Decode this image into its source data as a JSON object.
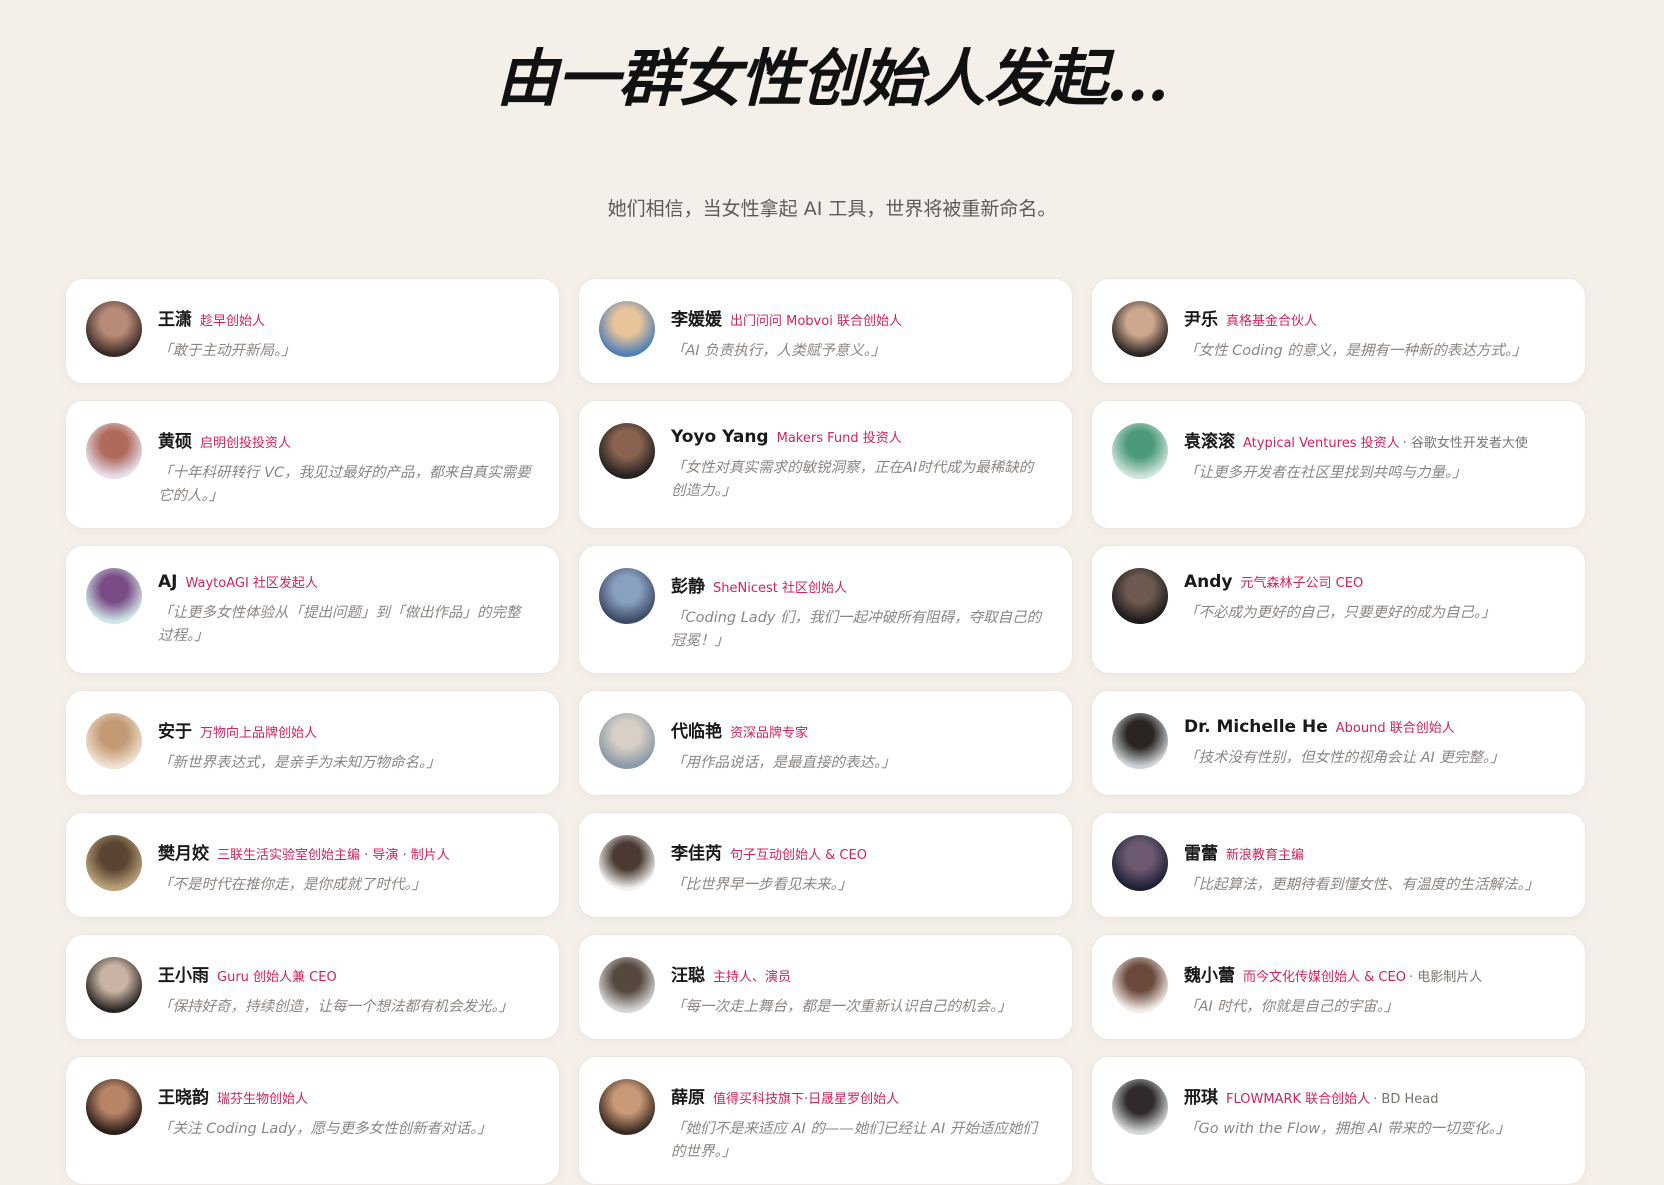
{
  "header": {
    "title": "由一群女性创始人发起...",
    "subtitle": "她们相信，当女性拿起 AI 工具，世界将被重新命名。"
  },
  "cards": [
    {
      "name": "王潇",
      "role": "趁早创始人",
      "extra": "",
      "quote": "「敢于主动开新局。」",
      "avatar_colors": [
        "#3a2a26",
        "#b88b78"
      ]
    },
    {
      "name": "李媛媛",
      "role": "出门问问 Mobvoi 联合创始人",
      "extra": "",
      "quote": "「AI 负责执行，人类赋予意义。」",
      "avatar_colors": [
        "#4f7fb4",
        "#e9c39a"
      ]
    },
    {
      "name": "尹乐",
      "role": "真格基金合伙人",
      "extra": "",
      "quote": "「女性 Coding 的意义，是拥有一种新的表达方式。」",
      "avatar_colors": [
        "#2b2623",
        "#cda88e"
      ]
    },
    {
      "name": "黄硕",
      "role": "启明创投投资人",
      "extra": "",
      "quote": "「十年科研转行 VC，我见过最好的产品，都来自真实需要它的人。」",
      "avatar_colors": [
        "#e8dfee",
        "#b06a5a"
      ]
    },
    {
      "name": "Yoyo Yang",
      "role": "Makers Fund 投资人",
      "extra": "",
      "quote": "「女性对真实需求的敏锐洞察，正在AI时代成为最稀缺的创造力。」",
      "avatar_colors": [
        "#23201f",
        "#8a6450"
      ]
    },
    {
      "name": "袁滚滚",
      "role": "Atypical Ventures 投资人",
      "extra": "· 谷歌女性开发者大使",
      "quote": "「让更多开发者在社区里找到共鸣与力量。」",
      "avatar_colors": [
        "#cfe4dc",
        "#4a9a7a"
      ]
    },
    {
      "name": "AJ",
      "role": "WaytoAGI 社区发起人",
      "extra": "",
      "quote": "「让更多女性体验从「提出问题」到「做出作品」的完整过程。」",
      "avatar_colors": [
        "#cfe7e6",
        "#7a4c86"
      ]
    },
    {
      "name": "彭静",
      "role": "SheNicest 社区创始人",
      "extra": "",
      "quote": "「Coding Lady 们，我们一起冲破所有阻碍，夺取自己的冠冕！」",
      "avatar_colors": [
        "#3d4a66",
        "#8aa0c0"
      ]
    },
    {
      "name": "Andy",
      "role": "元气森林子公司 CEO",
      "extra": "",
      "quote": "「不必成为更好的自己，只要更好的成为自己。」",
      "avatar_colors": [
        "#1e1b1b",
        "#6e5a50"
      ]
    },
    {
      "name": "安于",
      "role": "万物向上品牌创始人",
      "extra": "",
      "quote": "「新世界表达式，是亲手为未知万物命名。」",
      "avatar_colors": [
        "#efe2d2",
        "#c49a74"
      ]
    },
    {
      "name": "代临艳",
      "role": "资深品牌专家",
      "extra": "",
      "quote": "「用作品说话，是最直接的表达。」",
      "avatar_colors": [
        "#8a9aa8",
        "#d8cfc6"
      ]
    },
    {
      "name": "Dr. Michelle He",
      "role": "Abound 联合创始人",
      "extra": "",
      "quote": "「技术没有性别，但女性的视角会让 AI 更完整。」",
      "avatar_colors": [
        "#cdd3d6",
        "#2a2522"
      ]
    },
    {
      "name": "樊月姣",
      "role": "三联生活实验室创始主编 · 导演 · 制片人",
      "extra": "",
      "quote": "「不是时代在推你走，是你成就了时代。」",
      "avatar_colors": [
        "#b9a27a",
        "#5a4432"
      ]
    },
    {
      "name": "李佳芮",
      "role": "句子互动创始人 & CEO",
      "extra": "",
      "quote": "「比世界早一步看见未来。」",
      "avatar_colors": [
        "#f3f1ef",
        "#4a3a33"
      ]
    },
    {
      "name": "雷蕾",
      "role": "新浪教育主编",
      "extra": "",
      "quote": "「比起算法，更期待看到懂女性、有温度的生活解法。」",
      "avatar_colors": [
        "#1d2036",
        "#6d5a70"
      ]
    },
    {
      "name": "王小雨",
      "role": "Guru 创始人兼 CEO",
      "extra": "",
      "quote": "「保持好奇，持续创造，让每一个想法都有机会发光。」",
      "avatar_colors": [
        "#2a2624",
        "#c9b3a4"
      ]
    },
    {
      "name": "汪聪",
      "role": "主持人、演员",
      "extra": "",
      "quote": "「每一次走上舞台，都是一次重新认识自己的机会。」",
      "avatar_colors": [
        "#d6d4d2",
        "#56473f"
      ]
    },
    {
      "name": "魏小蕾",
      "role": "而今文化传媒创始人 & CEO",
      "extra": "· 电影制片人",
      "quote": "「AI 时代，你就是自己的宇宙。」",
      "avatar_colors": [
        "#f1ebe7",
        "#6a4a3c"
      ]
    },
    {
      "name": "王晓韵",
      "role": "瑞芬生物创始人",
      "extra": "",
      "quote": "「关注 Coding Lady，愿与更多女性创新者对话。」",
      "avatar_colors": [
        "#2a1d18",
        "#b78468"
      ]
    },
    {
      "name": "薛原",
      "role": "值得买科技旗下·日晟星罗创始人",
      "extra": "",
      "quote": "「她们不是来适应 AI 的——她们已经让 AI 开始适应她们的世界。」",
      "avatar_colors": [
        "#3a2a22",
        "#c99a78"
      ]
    },
    {
      "name": "邢琪",
      "role": "FLOWMARK 联合创始人",
      "extra": "· BD Head",
      "quote": "「Go with the Flow，拥抱 AI 带来的一切变化。」",
      "avatar_colors": [
        "#d4d7d8",
        "#2e2b2a"
      ]
    }
  ]
}
